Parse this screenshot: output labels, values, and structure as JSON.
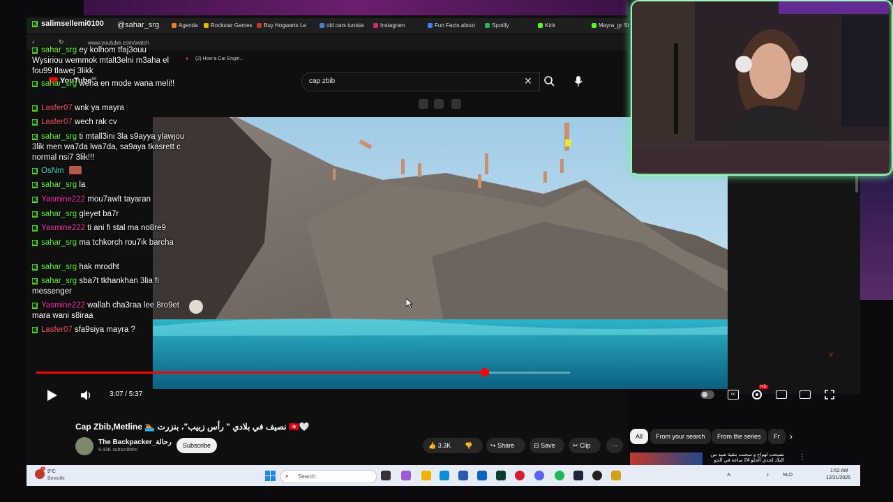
{
  "browser": {
    "bookmarks": [
      {
        "label": "Rockstar Games",
        "color": "#e6b800"
      },
      {
        "label": "Buy Hogwarts Le",
        "color": "#cc3333"
      },
      {
        "label": "old cars tunisia",
        "color": "#4a7dd8"
      },
      {
        "label": "Instagram",
        "color": "#d62976"
      },
      {
        "label": "Fun Facts about",
        "color": "#3b82f6"
      },
      {
        "label": "Spotify",
        "color": "#1db954"
      },
      {
        "label": "Kick",
        "color": "#53fc18"
      },
      {
        "label": "Mayra_gr St",
        "color": "#53fc18"
      }
    ],
    "bookmark_agenda": "Agenda",
    "url": "www.youtube.com/watch",
    "second_tab": "(2) How a Car Engin...",
    "youtube_logo": "YouTube",
    "youtube_region": "BE"
  },
  "search": {
    "query": "cap zbib"
  },
  "player": {
    "time": "3:07 / 5:37",
    "progress": 0.84,
    "hd_badge": "HD",
    "watermark": "V"
  },
  "video": {
    "title": "Cap Zbib,Metline 🏊 نصيف في بلادي \" رأس زبيب\"، بنزرت 🇹🇳🤍",
    "channel": "The Backpacker_رحالة",
    "subscribers": "9.43K subscribers",
    "subscribe_label": "Subscribe",
    "likes": "3.3K",
    "share_label": "Share",
    "save_label": "Save",
    "clip_label": "Clip"
  },
  "sidebar": {
    "chips": [
      "All",
      "From your search",
      "From the series",
      "Fr"
    ],
    "next_video_title": "نصيحت لهواح و سحنت بنقية صيد من",
    "next_video_subtitle": "البلاد لحدي الحلو 24 ساعة في الحو"
  },
  "stream": {
    "overlay_username": "salimsellemi0100",
    "overlay_handle": "@sahar_srg",
    "overlay_snippet": "Wysiriou wemmok mtalt3elni m3aha el",
    "overlay_snippet2": "fou99 tlawej 3likk"
  },
  "chat": [
    {
      "user": "sahar_srg",
      "color": "green",
      "text": "ey kolhom tfaj3ouu"
    },
    {
      "user": "sahar_srg",
      "color": "green",
      "text": "wena en mode wana meli!!"
    },
    {
      "user": "Lasfer07",
      "color": "red",
      "text": "wnk ya mayra"
    },
    {
      "user": "Lasfer07",
      "color": "red",
      "text": "wech rak cv"
    },
    {
      "user": "sahar_srg",
      "color": "green",
      "text": "ti mtall3ini 3la s9ayya ylawjou 3lik men wa7da lwa7da, sa9aya tkasrett c normal nsi7 3lik!!!"
    },
    {
      "user": "OsNm",
      "color": "teal",
      "text": ""
    },
    {
      "user": "sahar_srg",
      "color": "green",
      "text": "la"
    },
    {
      "user": "Yasmine222",
      "color": "pink",
      "text": "mou7awlt tayaran"
    },
    {
      "user": "sahar_srg",
      "color": "green",
      "text": "gleyet ba7r"
    },
    {
      "user": "Yasmine222",
      "color": "pink",
      "text": "ti ani fi stal ma no8re9"
    },
    {
      "user": "sahar_srg",
      "color": "green",
      "text": "ma tchkorch rou7ik barcha"
    },
    {
      "user": "sahar_srg",
      "color": "green",
      "text": "hak mrodht"
    },
    {
      "user": "sahar_srg",
      "color": "green",
      "text": "sba7t tkhankhan 3lia fi messenger"
    },
    {
      "user": "Yasmine222",
      "color": "pink",
      "text": "wallah cha3raa lee 8ro9et mara wani s8iraa"
    },
    {
      "user": "Lasfer07",
      "color": "red",
      "text": "sfa9siya mayra ?"
    }
  ],
  "taskbar": {
    "weather_temp": "9°C",
    "weather_desc": "Bewolkt",
    "weather_badge": "1",
    "search_placeholder": "Search",
    "lang": "NLD",
    "time": "1:52 AM",
    "date": "12/21/2025"
  }
}
